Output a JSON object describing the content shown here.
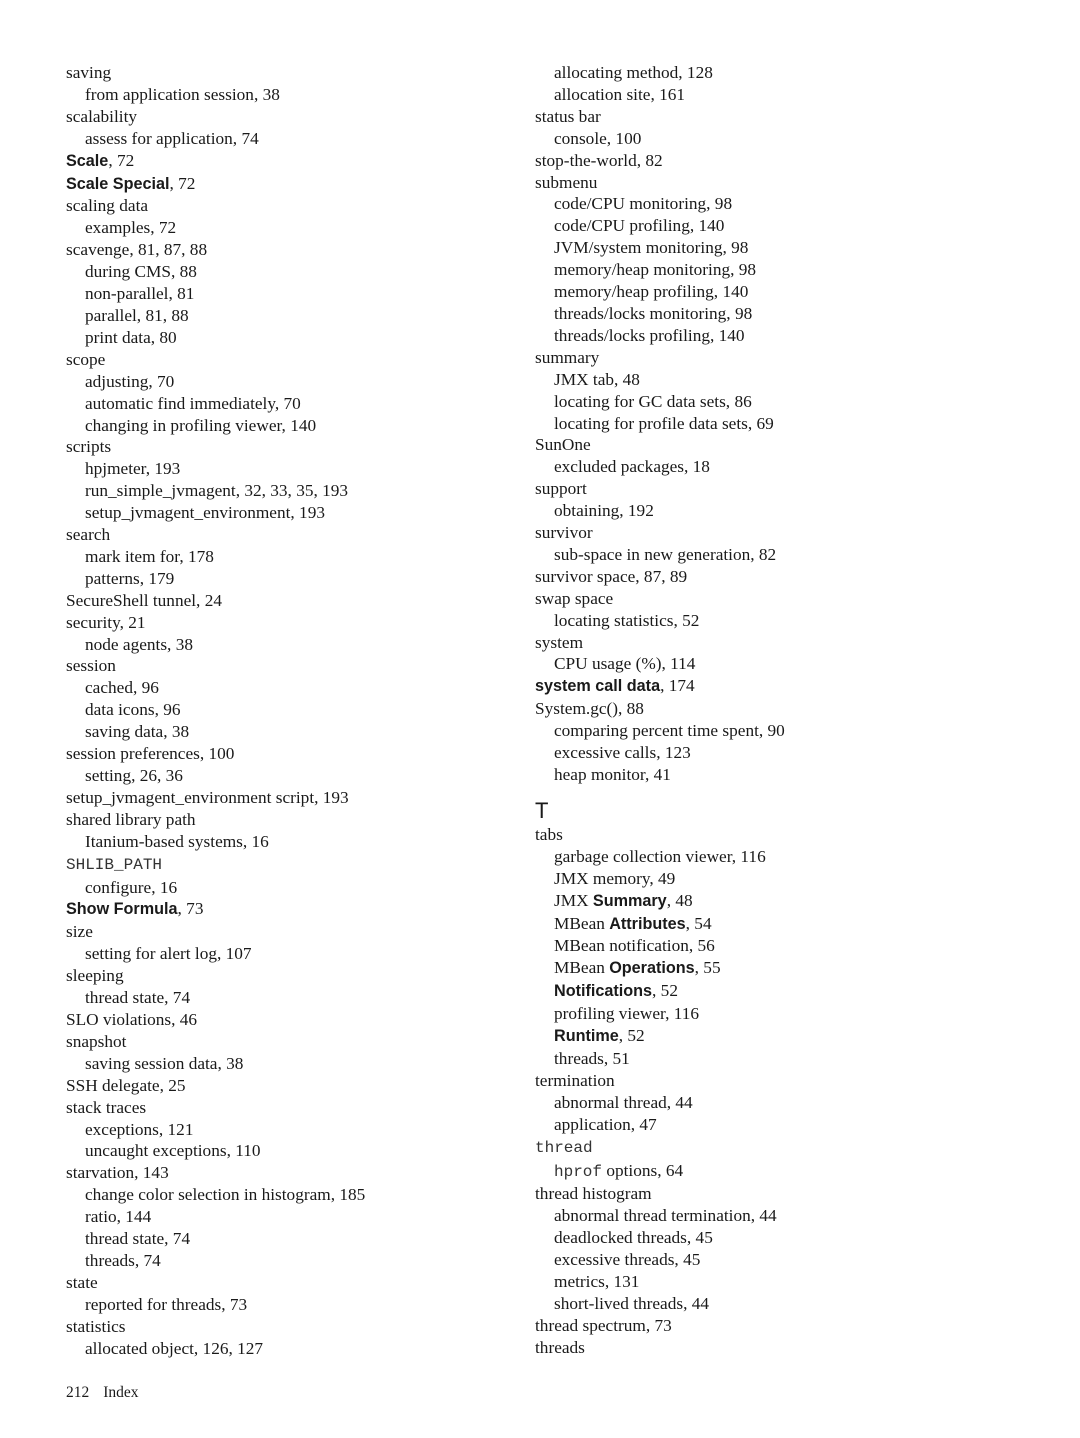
{
  "page": {
    "number": "212",
    "section": "Index"
  },
  "left_column": [
    {
      "lvl": 0,
      "parts": [
        {
          "t": "saving"
        }
      ]
    },
    {
      "lvl": 1,
      "parts": [
        {
          "t": "from application session, 38"
        }
      ]
    },
    {
      "lvl": 0,
      "parts": [
        {
          "t": "scalability"
        }
      ]
    },
    {
      "lvl": 1,
      "parts": [
        {
          "t": "assess for application, 74"
        }
      ]
    },
    {
      "lvl": 0,
      "parts": [
        {
          "t": "Scale",
          "s": "b"
        },
        {
          "t": ", 72"
        }
      ]
    },
    {
      "lvl": 0,
      "parts": [
        {
          "t": "Scale Special",
          "s": "b"
        },
        {
          "t": ", 72"
        }
      ]
    },
    {
      "lvl": 0,
      "parts": [
        {
          "t": "scaling data"
        }
      ]
    },
    {
      "lvl": 1,
      "parts": [
        {
          "t": "examples, 72"
        }
      ]
    },
    {
      "lvl": 0,
      "parts": [
        {
          "t": "scavenge, 81, 87, 88"
        }
      ]
    },
    {
      "lvl": 1,
      "parts": [
        {
          "t": "during CMS, 88"
        }
      ]
    },
    {
      "lvl": 1,
      "parts": [
        {
          "t": "non-parallel, 81"
        }
      ]
    },
    {
      "lvl": 1,
      "parts": [
        {
          "t": "parallel, 81, 88"
        }
      ]
    },
    {
      "lvl": 1,
      "parts": [
        {
          "t": "print data, 80"
        }
      ]
    },
    {
      "lvl": 0,
      "parts": [
        {
          "t": "scope"
        }
      ]
    },
    {
      "lvl": 1,
      "parts": [
        {
          "t": "adjusting, 70"
        }
      ]
    },
    {
      "lvl": 1,
      "parts": [
        {
          "t": "automatic find immediately, 70"
        }
      ]
    },
    {
      "lvl": 1,
      "parts": [
        {
          "t": "changing in profiling viewer, 140"
        }
      ]
    },
    {
      "lvl": 0,
      "parts": [
        {
          "t": "scripts"
        }
      ]
    },
    {
      "lvl": 1,
      "parts": [
        {
          "t": "hpjmeter, 193"
        }
      ]
    },
    {
      "lvl": 1,
      "parts": [
        {
          "t": "run_simple_jvmagent, 32, 33, 35, 193"
        }
      ]
    },
    {
      "lvl": 1,
      "parts": [
        {
          "t": "setup_jvmagent_environment, 193"
        }
      ]
    },
    {
      "lvl": 0,
      "parts": [
        {
          "t": "search"
        }
      ]
    },
    {
      "lvl": 1,
      "parts": [
        {
          "t": "mark item for, 178"
        }
      ]
    },
    {
      "lvl": 1,
      "parts": [
        {
          "t": "patterns, 179"
        }
      ]
    },
    {
      "lvl": 0,
      "parts": [
        {
          "t": "SecureShell tunnel, 24"
        }
      ]
    },
    {
      "lvl": 0,
      "parts": [
        {
          "t": "security, 21"
        }
      ]
    },
    {
      "lvl": 1,
      "parts": [
        {
          "t": "node agents, 38"
        }
      ]
    },
    {
      "lvl": 0,
      "parts": [
        {
          "t": "session"
        }
      ]
    },
    {
      "lvl": 1,
      "parts": [
        {
          "t": "cached, 96"
        }
      ]
    },
    {
      "lvl": 1,
      "parts": [
        {
          "t": "data icons, 96"
        }
      ]
    },
    {
      "lvl": 1,
      "parts": [
        {
          "t": "saving data, 38"
        }
      ]
    },
    {
      "lvl": 0,
      "parts": [
        {
          "t": "session preferences, 100"
        }
      ]
    },
    {
      "lvl": 1,
      "parts": [
        {
          "t": "setting, 26, 36"
        }
      ]
    },
    {
      "lvl": 0,
      "parts": [
        {
          "t": "setup_jvmagent_environment script, 193"
        }
      ]
    },
    {
      "lvl": 0,
      "parts": [
        {
          "t": "shared library path"
        }
      ]
    },
    {
      "lvl": 1,
      "parts": [
        {
          "t": "Itanium-based systems, 16"
        }
      ]
    },
    {
      "lvl": 0,
      "parts": [
        {
          "t": "SHLIB_PATH",
          "s": "m"
        }
      ]
    },
    {
      "lvl": 1,
      "parts": [
        {
          "t": "configure, 16"
        }
      ]
    },
    {
      "lvl": 0,
      "parts": [
        {
          "t": "Show Formula",
          "s": "b"
        },
        {
          "t": ", 73"
        }
      ]
    },
    {
      "lvl": 0,
      "parts": [
        {
          "t": "size"
        }
      ]
    },
    {
      "lvl": 1,
      "parts": [
        {
          "t": "setting for alert log, 107"
        }
      ]
    },
    {
      "lvl": 0,
      "parts": [
        {
          "t": "sleeping"
        }
      ]
    },
    {
      "lvl": 1,
      "parts": [
        {
          "t": "thread state, 74"
        }
      ]
    },
    {
      "lvl": 0,
      "parts": [
        {
          "t": "SLO violations, 46"
        }
      ]
    },
    {
      "lvl": 0,
      "parts": [
        {
          "t": "snapshot"
        }
      ]
    },
    {
      "lvl": 1,
      "parts": [
        {
          "t": "saving session data, 38"
        }
      ]
    },
    {
      "lvl": 0,
      "parts": [
        {
          "t": "SSH delegate, 25"
        }
      ]
    },
    {
      "lvl": 0,
      "parts": [
        {
          "t": "stack traces"
        }
      ]
    },
    {
      "lvl": 1,
      "parts": [
        {
          "t": "exceptions, 121"
        }
      ]
    },
    {
      "lvl": 1,
      "parts": [
        {
          "t": "uncaught exceptions, 110"
        }
      ]
    },
    {
      "lvl": 0,
      "parts": [
        {
          "t": "starvation, 143"
        }
      ]
    },
    {
      "lvl": 1,
      "parts": [
        {
          "t": "change color selection in histogram, 185"
        }
      ]
    },
    {
      "lvl": 1,
      "parts": [
        {
          "t": "ratio, 144"
        }
      ]
    },
    {
      "lvl": 1,
      "parts": [
        {
          "t": "thread state, 74"
        }
      ]
    },
    {
      "lvl": 1,
      "parts": [
        {
          "t": "threads, 74"
        }
      ]
    },
    {
      "lvl": 0,
      "parts": [
        {
          "t": "state"
        }
      ]
    },
    {
      "lvl": 1,
      "parts": [
        {
          "t": "reported for threads, 73"
        }
      ]
    },
    {
      "lvl": 0,
      "parts": [
        {
          "t": "statistics"
        }
      ]
    },
    {
      "lvl": 1,
      "parts": [
        {
          "t": "allocated object, 126, 127"
        }
      ]
    }
  ],
  "right_column": [
    {
      "lvl": 1,
      "parts": [
        {
          "t": "allocating method, 128"
        }
      ]
    },
    {
      "lvl": 1,
      "parts": [
        {
          "t": "allocation site, 161"
        }
      ]
    },
    {
      "lvl": 0,
      "parts": [
        {
          "t": "status bar"
        }
      ]
    },
    {
      "lvl": 1,
      "parts": [
        {
          "t": "console, 100"
        }
      ]
    },
    {
      "lvl": 0,
      "parts": [
        {
          "t": "stop-the-world, 82"
        }
      ]
    },
    {
      "lvl": 0,
      "parts": [
        {
          "t": "submenu"
        }
      ]
    },
    {
      "lvl": 1,
      "parts": [
        {
          "t": "code/CPU monitoring, 98"
        }
      ]
    },
    {
      "lvl": 1,
      "parts": [
        {
          "t": "code/CPU profiling, 140"
        }
      ]
    },
    {
      "lvl": 1,
      "parts": [
        {
          "t": "JVM/system monitoring, 98"
        }
      ]
    },
    {
      "lvl": 1,
      "parts": [
        {
          "t": "memory/heap monitoring, 98"
        }
      ]
    },
    {
      "lvl": 1,
      "parts": [
        {
          "t": "memory/heap profiling, 140"
        }
      ]
    },
    {
      "lvl": 1,
      "parts": [
        {
          "t": "threads/locks monitoring, 98"
        }
      ]
    },
    {
      "lvl": 1,
      "parts": [
        {
          "t": "threads/locks profiling, 140"
        }
      ]
    },
    {
      "lvl": 0,
      "parts": [
        {
          "t": "summary"
        }
      ]
    },
    {
      "lvl": 1,
      "parts": [
        {
          "t": "JMX tab, 48"
        }
      ]
    },
    {
      "lvl": 1,
      "parts": [
        {
          "t": "locating for GC data sets, 86"
        }
      ]
    },
    {
      "lvl": 1,
      "parts": [
        {
          "t": "locating for profile data sets, 69"
        }
      ]
    },
    {
      "lvl": 0,
      "parts": [
        {
          "t": "SunOne"
        }
      ]
    },
    {
      "lvl": 1,
      "parts": [
        {
          "t": "excluded packages, 18"
        }
      ]
    },
    {
      "lvl": 0,
      "parts": [
        {
          "t": "support"
        }
      ]
    },
    {
      "lvl": 1,
      "parts": [
        {
          "t": "obtaining, 192"
        }
      ]
    },
    {
      "lvl": 0,
      "parts": [
        {
          "t": "survivor"
        }
      ]
    },
    {
      "lvl": 1,
      "parts": [
        {
          "t": "sub-space in new generation, 82"
        }
      ]
    },
    {
      "lvl": 0,
      "parts": [
        {
          "t": "survivor space, 87, 89"
        }
      ]
    },
    {
      "lvl": 0,
      "parts": [
        {
          "t": "swap space"
        }
      ]
    },
    {
      "lvl": 1,
      "parts": [
        {
          "t": "locating statistics, 52"
        }
      ]
    },
    {
      "lvl": 0,
      "parts": [
        {
          "t": "system"
        }
      ]
    },
    {
      "lvl": 1,
      "parts": [
        {
          "t": "CPU usage (%), 114"
        }
      ]
    },
    {
      "lvl": 0,
      "parts": [
        {
          "t": "system call data",
          "s": "b"
        },
        {
          "t": ", 174"
        }
      ]
    },
    {
      "lvl": 0,
      "parts": [
        {
          "t": "System.gc(), 88"
        }
      ]
    },
    {
      "lvl": 1,
      "parts": [
        {
          "t": "comparing percent time spent, 90"
        }
      ]
    },
    {
      "lvl": 1,
      "parts": [
        {
          "t": "excessive calls, 123"
        }
      ]
    },
    {
      "lvl": 1,
      "parts": [
        {
          "t": "heap monitor, 41"
        }
      ]
    },
    {
      "lvl": "letter",
      "parts": [
        {
          "t": "T"
        }
      ]
    },
    {
      "lvl": 0,
      "parts": [
        {
          "t": "tabs"
        }
      ]
    },
    {
      "lvl": 1,
      "parts": [
        {
          "t": "garbage collection viewer, 116"
        }
      ]
    },
    {
      "lvl": 1,
      "parts": [
        {
          "t": "JMX memory, 49"
        }
      ]
    },
    {
      "lvl": 1,
      "parts": [
        {
          "t": "JMX "
        },
        {
          "t": "Summary",
          "s": "b"
        },
        {
          "t": ", 48"
        }
      ]
    },
    {
      "lvl": 1,
      "parts": [
        {
          "t": "MBean "
        },
        {
          "t": "Attributes",
          "s": "b"
        },
        {
          "t": ", 54"
        }
      ]
    },
    {
      "lvl": 1,
      "parts": [
        {
          "t": "MBean notification, 56"
        }
      ]
    },
    {
      "lvl": 1,
      "parts": [
        {
          "t": "MBean "
        },
        {
          "t": "Operations",
          "s": "b"
        },
        {
          "t": ", 55"
        }
      ]
    },
    {
      "lvl": 1,
      "parts": [
        {
          "t": "Notifications",
          "s": "b"
        },
        {
          "t": ", 52"
        }
      ]
    },
    {
      "lvl": 1,
      "parts": [
        {
          "t": "profiling viewer, 116"
        }
      ]
    },
    {
      "lvl": 1,
      "parts": [
        {
          "t": "Runtime",
          "s": "b"
        },
        {
          "t": ", 52"
        }
      ]
    },
    {
      "lvl": 1,
      "parts": [
        {
          "t": "threads, 51"
        }
      ]
    },
    {
      "lvl": 0,
      "parts": [
        {
          "t": "termination"
        }
      ]
    },
    {
      "lvl": 1,
      "parts": [
        {
          "t": "abnormal thread, 44"
        }
      ]
    },
    {
      "lvl": 1,
      "parts": [
        {
          "t": "application, 47"
        }
      ]
    },
    {
      "lvl": 0,
      "parts": [
        {
          "t": "thread",
          "s": "m"
        }
      ]
    },
    {
      "lvl": 1,
      "parts": [
        {
          "t": "hprof",
          "s": "m"
        },
        {
          "t": " options, 64"
        }
      ]
    },
    {
      "lvl": 0,
      "parts": [
        {
          "t": "thread histogram"
        }
      ]
    },
    {
      "lvl": 1,
      "parts": [
        {
          "t": "abnormal thread termination, 44"
        }
      ]
    },
    {
      "lvl": 1,
      "parts": [
        {
          "t": "deadlocked threads, 45"
        }
      ]
    },
    {
      "lvl": 1,
      "parts": [
        {
          "t": "excessive threads, 45"
        }
      ]
    },
    {
      "lvl": 1,
      "parts": [
        {
          "t": "metrics, 131"
        }
      ]
    },
    {
      "lvl": 1,
      "parts": [
        {
          "t": "short-lived threads, 44"
        }
      ]
    },
    {
      "lvl": 0,
      "parts": [
        {
          "t": "thread spectrum, 73"
        }
      ]
    },
    {
      "lvl": 0,
      "parts": [
        {
          "t": "threads"
        }
      ]
    }
  ]
}
